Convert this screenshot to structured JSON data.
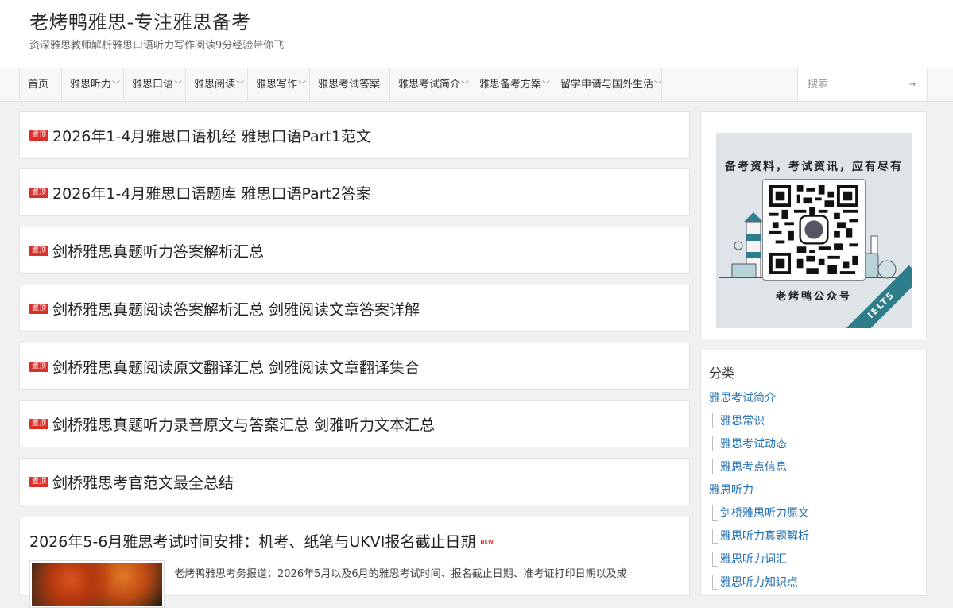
{
  "site": {
    "title": "老烤鸭雅思-专注雅思备考",
    "description": "资深雅思教师解析雅思口语听力写作阅读9分经验带你飞"
  },
  "nav": {
    "items": [
      {
        "label": "首页",
        "has_dropdown": false
      },
      {
        "label": "雅思听力",
        "has_dropdown": true
      },
      {
        "label": "雅思口语",
        "has_dropdown": true
      },
      {
        "label": "雅思阅读",
        "has_dropdown": true
      },
      {
        "label": "雅思写作",
        "has_dropdown": true
      },
      {
        "label": "雅思考试答案",
        "has_dropdown": false
      },
      {
        "label": "雅思考试简介",
        "has_dropdown": true
      },
      {
        "label": "雅思备考方案",
        "has_dropdown": true
      },
      {
        "label": "留学申请与国外生活",
        "has_dropdown": true
      }
    ],
    "dropdown_icon": "chevron-down-icon",
    "search_placeholder": "搜索",
    "search_icon": "arrow-right-icon"
  },
  "sticky_posts": {
    "badge": "置顶",
    "badge_color": "#d9302c",
    "items": [
      "2026年1-4月雅思口语机经 雅思口语Part1范文",
      "2026年1-4月雅思口语题库 雅思口语Part2答案",
      "剑桥雅思真题听力答案解析汇总",
      "剑桥雅思真题阅读答案解析汇总 剑雅阅读文章答案详解",
      "剑桥雅思真题阅读原文翻译汇总 剑雅阅读文章翻译集合",
      "剑桥雅思真题听力录音原文与答案汇总 剑雅听力文本汇总",
      "剑桥雅思考官范文最全总结"
    ]
  },
  "latest_post": {
    "title": "2026年5-6月雅思考试时间安排：机考、纸笔与UKVI报名截止日期",
    "new_badge": "NEW",
    "excerpt": "老烤鸭雅思考务报道：2026年5月以及6月的雅思考试时间、报名截止日期、准考证打印日期以及成"
  },
  "sidebar": {
    "qr": {
      "caption_top": "备考资料，考试资讯，应有尽有",
      "caption_bottom": "老烤鸭公众号",
      "band_label": "IELTS",
      "band_color": "#2e7d8a"
    },
    "categories": {
      "title": "分类",
      "link_color": "#1f6fb5",
      "items": [
        {
          "label": "雅思考试简介",
          "level": 0
        },
        {
          "label": "雅思常识",
          "level": 1
        },
        {
          "label": "雅思考试动态",
          "level": 1
        },
        {
          "label": "雅思考点信息",
          "level": 1
        },
        {
          "label": "雅思听力",
          "level": 0
        },
        {
          "label": "剑桥雅思听力原文",
          "level": 1
        },
        {
          "label": "雅思听力真题解析",
          "level": 1
        },
        {
          "label": "雅思听力词汇",
          "level": 1
        },
        {
          "label": "雅思听力知识点",
          "level": 1
        }
      ]
    }
  }
}
